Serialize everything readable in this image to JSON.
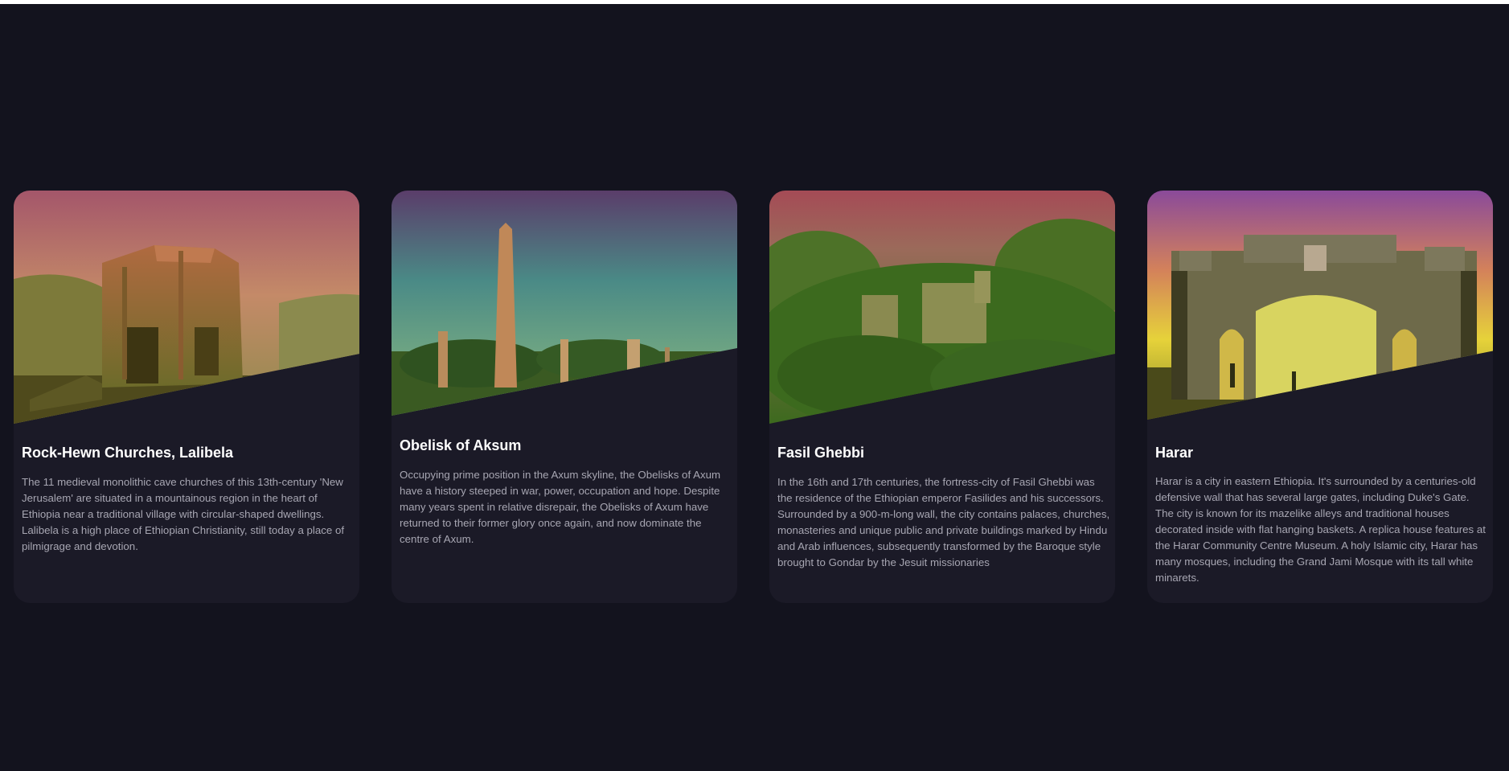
{
  "cards": [
    {
      "title": "Rock-Hewn Churches, Lalibela",
      "description": "The 11 medieval monolithic cave churches of this 13th-century 'New Jerusalem' are situated in a mountainous region in the heart of Ethiopia near a traditional village with circular-shaped dwellings. Lalibela is a high place of Ethiopian Christianity, still today a place of pilmigrage and devotion."
    },
    {
      "title": "Obelisk of Aksum",
      "description": "Occupying prime position in the Axum skyline, the Obelisks of Axum have a history steeped in war, power, occupation and hope. Despite many years spent in relative disrepair, the Obelisks of Axum have returned to their former glory once again, and now dominate the centre of Axum."
    },
    {
      "title": "Fasil Ghebbi",
      "description": "In the 16th and 17th centuries, the fortress-city of Fasil Ghebbi was the residence of the Ethiopian emperor Fasilides and his successors. Surrounded by a 900-m-long wall, the city contains palaces, churches, monasteries and unique public and private buildings marked by Hindu and Arab influences, subsequently transformed by the Baroque style brought to Gondar by the Jesuit missionaries"
    },
    {
      "title": "Harar",
      "description": "Harar is a city in eastern Ethiopia. It's surrounded by a centuries-old defensive wall that has several large gates, including Duke's Gate. The city is known for its mazelike alleys and traditional houses decorated inside with flat hanging baskets. A replica house features at the Harar Community Centre Museum. A holy Islamic city, Harar has many mosques, including the Grand Jami Mosque with its tall white minarets."
    }
  ],
  "colors": {
    "background": "#13131e",
    "card": "#1b1a27",
    "title": "#ffffff",
    "text": "#a7a6b2"
  }
}
